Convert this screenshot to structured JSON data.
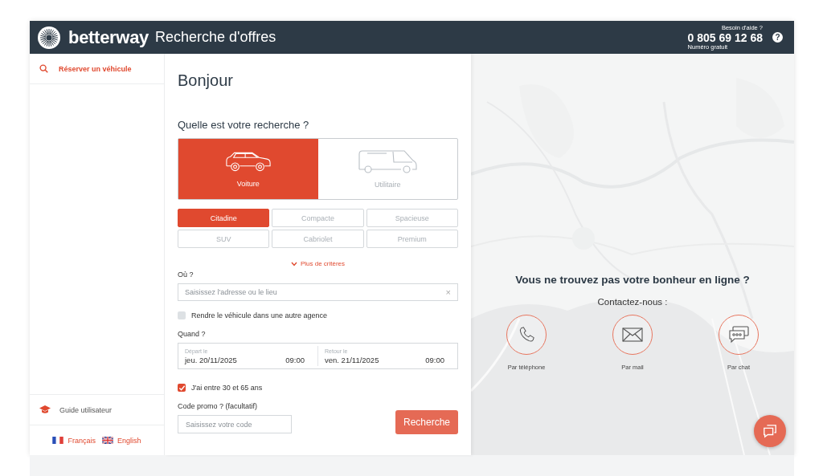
{
  "header": {
    "brand": "betterway",
    "title": "Recherche d'offres",
    "help_label": "Besoin d'aide ?",
    "phone": "0 805 69 12 68",
    "phone_note": "Numéro gratuit",
    "help_icon": "?"
  },
  "sidebar": {
    "items": [
      {
        "label": "Réserver un véhicule",
        "selected": true
      }
    ],
    "footer_link": "Guide utilisateur",
    "languages": [
      {
        "label": "Français",
        "kind": "fr"
      },
      {
        "label": "English",
        "kind": "en"
      }
    ]
  },
  "form": {
    "greeting": "Bonjour",
    "question": "Quelle est votre recherche ?",
    "vehicle_types": [
      {
        "label": "Voiture",
        "kind": "car",
        "selected": true
      },
      {
        "label": "Utilitaire",
        "kind": "van",
        "selected": false
      }
    ],
    "categories": [
      {
        "label": "Citadine",
        "selected": true
      },
      {
        "label": "Compacte",
        "selected": false
      },
      {
        "label": "Spacieuse",
        "selected": false
      },
      {
        "label": "SUV",
        "selected": false
      },
      {
        "label": "Cabriolet",
        "selected": false
      },
      {
        "label": "Premium",
        "selected": false
      }
    ],
    "more_criteria": "Plus de critères",
    "where_label": "Où ?",
    "where_placeholder": "Saisissez l'adresse ou le lieu",
    "clear": "×",
    "other_agency": {
      "label": "Rendre le véhicule dans une autre agence",
      "checked": false
    },
    "when_label": "Quand ?",
    "dates": [
      {
        "label": "Départ le",
        "date": "jeu. 20/11/2025",
        "time": "09:00"
      },
      {
        "label": "Retour le",
        "date": "ven. 21/11/2025",
        "time": "09:00"
      }
    ],
    "age": {
      "label": "J'ai entre 30 et 65 ans",
      "checked": true
    },
    "promo_label": "Code promo ? (facultatif)",
    "promo_placeholder": "Saisissez votre code",
    "submit": "Recherche"
  },
  "contact": {
    "title": "Vous ne trouvez pas votre bonheur en ligne ?",
    "subtitle": "Contactez-nous :",
    "channels": [
      {
        "label": "Par téléphone",
        "kind": "phone"
      },
      {
        "label": "Par mail",
        "kind": "mail"
      },
      {
        "label": "Par chat",
        "kind": "chat"
      }
    ]
  }
}
